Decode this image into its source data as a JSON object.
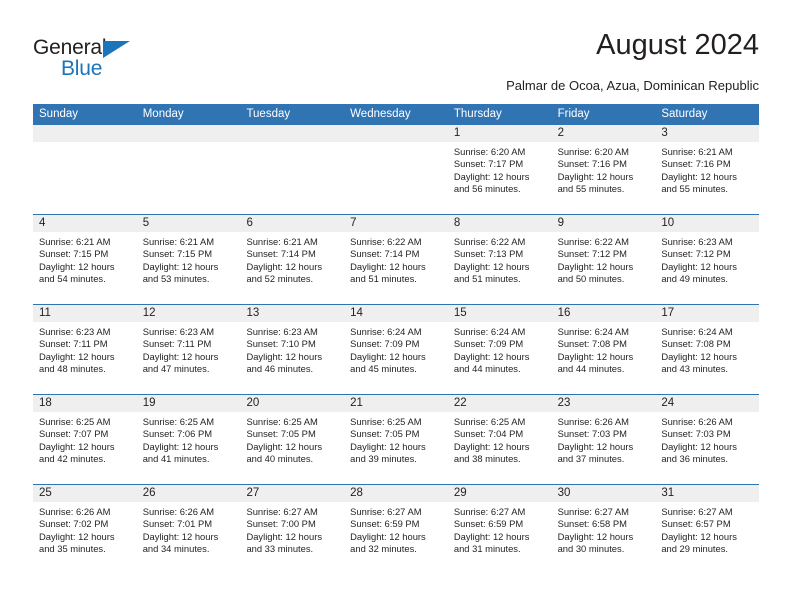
{
  "brand": {
    "name_part1": "General",
    "name_part2": "Blue",
    "triangle_icon": "blue-triangle-icon",
    "accent_color": "#1b75bb"
  },
  "header": {
    "title": "August 2024",
    "subtitle": "Palmar de Ocoa, Azua, Dominican Republic"
  },
  "calendar": {
    "header_color": "#3174b4",
    "day_band_color": "#efeff0",
    "weekdays": [
      "Sunday",
      "Monday",
      "Tuesday",
      "Wednesday",
      "Thursday",
      "Friday",
      "Saturday"
    ],
    "weeks": [
      [
        {
          "day": "",
          "empty": true
        },
        {
          "day": "",
          "empty": true
        },
        {
          "day": "",
          "empty": true
        },
        {
          "day": "",
          "empty": true
        },
        {
          "day": "1",
          "sunrise": "Sunrise: 6:20 AM",
          "sunset": "Sunset: 7:17 PM",
          "daylight_line1": "Daylight: 12 hours",
          "daylight_line2": "and 56 minutes."
        },
        {
          "day": "2",
          "sunrise": "Sunrise: 6:20 AM",
          "sunset": "Sunset: 7:16 PM",
          "daylight_line1": "Daylight: 12 hours",
          "daylight_line2": "and 55 minutes."
        },
        {
          "day": "3",
          "sunrise": "Sunrise: 6:21 AM",
          "sunset": "Sunset: 7:16 PM",
          "daylight_line1": "Daylight: 12 hours",
          "daylight_line2": "and 55 minutes."
        }
      ],
      [
        {
          "day": "4",
          "sunrise": "Sunrise: 6:21 AM",
          "sunset": "Sunset: 7:15 PM",
          "daylight_line1": "Daylight: 12 hours",
          "daylight_line2": "and 54 minutes."
        },
        {
          "day": "5",
          "sunrise": "Sunrise: 6:21 AM",
          "sunset": "Sunset: 7:15 PM",
          "daylight_line1": "Daylight: 12 hours",
          "daylight_line2": "and 53 minutes."
        },
        {
          "day": "6",
          "sunrise": "Sunrise: 6:21 AM",
          "sunset": "Sunset: 7:14 PM",
          "daylight_line1": "Daylight: 12 hours",
          "daylight_line2": "and 52 minutes."
        },
        {
          "day": "7",
          "sunrise": "Sunrise: 6:22 AM",
          "sunset": "Sunset: 7:14 PM",
          "daylight_line1": "Daylight: 12 hours",
          "daylight_line2": "and 51 minutes."
        },
        {
          "day": "8",
          "sunrise": "Sunrise: 6:22 AM",
          "sunset": "Sunset: 7:13 PM",
          "daylight_line1": "Daylight: 12 hours",
          "daylight_line2": "and 51 minutes."
        },
        {
          "day": "9",
          "sunrise": "Sunrise: 6:22 AM",
          "sunset": "Sunset: 7:12 PM",
          "daylight_line1": "Daylight: 12 hours",
          "daylight_line2": "and 50 minutes."
        },
        {
          "day": "10",
          "sunrise": "Sunrise: 6:23 AM",
          "sunset": "Sunset: 7:12 PM",
          "daylight_line1": "Daylight: 12 hours",
          "daylight_line2": "and 49 minutes."
        }
      ],
      [
        {
          "day": "11",
          "sunrise": "Sunrise: 6:23 AM",
          "sunset": "Sunset: 7:11 PM",
          "daylight_line1": "Daylight: 12 hours",
          "daylight_line2": "and 48 minutes."
        },
        {
          "day": "12",
          "sunrise": "Sunrise: 6:23 AM",
          "sunset": "Sunset: 7:11 PM",
          "daylight_line1": "Daylight: 12 hours",
          "daylight_line2": "and 47 minutes."
        },
        {
          "day": "13",
          "sunrise": "Sunrise: 6:23 AM",
          "sunset": "Sunset: 7:10 PM",
          "daylight_line1": "Daylight: 12 hours",
          "daylight_line2": "and 46 minutes."
        },
        {
          "day": "14",
          "sunrise": "Sunrise: 6:24 AM",
          "sunset": "Sunset: 7:09 PM",
          "daylight_line1": "Daylight: 12 hours",
          "daylight_line2": "and 45 minutes."
        },
        {
          "day": "15",
          "sunrise": "Sunrise: 6:24 AM",
          "sunset": "Sunset: 7:09 PM",
          "daylight_line1": "Daylight: 12 hours",
          "daylight_line2": "and 44 minutes."
        },
        {
          "day": "16",
          "sunrise": "Sunrise: 6:24 AM",
          "sunset": "Sunset: 7:08 PM",
          "daylight_line1": "Daylight: 12 hours",
          "daylight_line2": "and 44 minutes."
        },
        {
          "day": "17",
          "sunrise": "Sunrise: 6:24 AM",
          "sunset": "Sunset: 7:08 PM",
          "daylight_line1": "Daylight: 12 hours",
          "daylight_line2": "and 43 minutes."
        }
      ],
      [
        {
          "day": "18",
          "sunrise": "Sunrise: 6:25 AM",
          "sunset": "Sunset: 7:07 PM",
          "daylight_line1": "Daylight: 12 hours",
          "daylight_line2": "and 42 minutes."
        },
        {
          "day": "19",
          "sunrise": "Sunrise: 6:25 AM",
          "sunset": "Sunset: 7:06 PM",
          "daylight_line1": "Daylight: 12 hours",
          "daylight_line2": "and 41 minutes."
        },
        {
          "day": "20",
          "sunrise": "Sunrise: 6:25 AM",
          "sunset": "Sunset: 7:05 PM",
          "daylight_line1": "Daylight: 12 hours",
          "daylight_line2": "and 40 minutes."
        },
        {
          "day": "21",
          "sunrise": "Sunrise: 6:25 AM",
          "sunset": "Sunset: 7:05 PM",
          "daylight_line1": "Daylight: 12 hours",
          "daylight_line2": "and 39 minutes."
        },
        {
          "day": "22",
          "sunrise": "Sunrise: 6:25 AM",
          "sunset": "Sunset: 7:04 PM",
          "daylight_line1": "Daylight: 12 hours",
          "daylight_line2": "and 38 minutes."
        },
        {
          "day": "23",
          "sunrise": "Sunrise: 6:26 AM",
          "sunset": "Sunset: 7:03 PM",
          "daylight_line1": "Daylight: 12 hours",
          "daylight_line2": "and 37 minutes."
        },
        {
          "day": "24",
          "sunrise": "Sunrise: 6:26 AM",
          "sunset": "Sunset: 7:03 PM",
          "daylight_line1": "Daylight: 12 hours",
          "daylight_line2": "and 36 minutes."
        }
      ],
      [
        {
          "day": "25",
          "sunrise": "Sunrise: 6:26 AM",
          "sunset": "Sunset: 7:02 PM",
          "daylight_line1": "Daylight: 12 hours",
          "daylight_line2": "and 35 minutes."
        },
        {
          "day": "26",
          "sunrise": "Sunrise: 6:26 AM",
          "sunset": "Sunset: 7:01 PM",
          "daylight_line1": "Daylight: 12 hours",
          "daylight_line2": "and 34 minutes."
        },
        {
          "day": "27",
          "sunrise": "Sunrise: 6:27 AM",
          "sunset": "Sunset: 7:00 PM",
          "daylight_line1": "Daylight: 12 hours",
          "daylight_line2": "and 33 minutes."
        },
        {
          "day": "28",
          "sunrise": "Sunrise: 6:27 AM",
          "sunset": "Sunset: 6:59 PM",
          "daylight_line1": "Daylight: 12 hours",
          "daylight_line2": "and 32 minutes."
        },
        {
          "day": "29",
          "sunrise": "Sunrise: 6:27 AM",
          "sunset": "Sunset: 6:59 PM",
          "daylight_line1": "Daylight: 12 hours",
          "daylight_line2": "and 31 minutes."
        },
        {
          "day": "30",
          "sunrise": "Sunrise: 6:27 AM",
          "sunset": "Sunset: 6:58 PM",
          "daylight_line1": "Daylight: 12 hours",
          "daylight_line2": "and 30 minutes."
        },
        {
          "day": "31",
          "sunrise": "Sunrise: 6:27 AM",
          "sunset": "Sunset: 6:57 PM",
          "daylight_line1": "Daylight: 12 hours",
          "daylight_line2": "and 29 minutes."
        }
      ]
    ]
  }
}
